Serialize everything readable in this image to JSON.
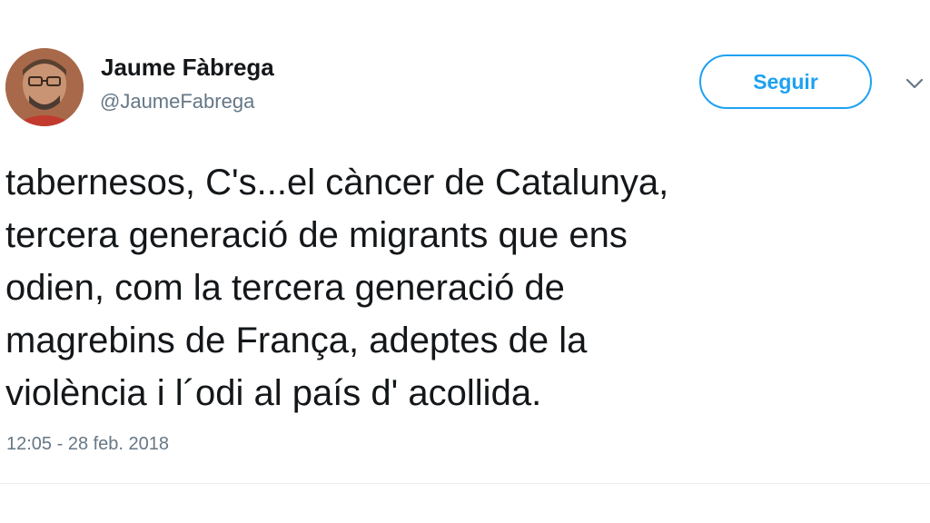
{
  "author": {
    "display_name": "Jaume Fàbrega",
    "handle": "@JaumeFabrega",
    "avatar_icon": "profile-photo"
  },
  "actions": {
    "follow_label": "Seguir",
    "menu_icon": "chevron-down-icon"
  },
  "tweet": {
    "text": "tabernesos,   C's...el càncer de Catalunya,\ntercera generació de migrants que  ens\nodien, com la tercera generació de\nmagrebins de França, adeptes de  la\nviolència i l´odi al país d' acollida.",
    "timestamp": "12:05 - 28 feb. 2018"
  },
  "colors": {
    "accent": "#1da1f2",
    "text_primary": "#14171a",
    "text_secondary": "#657786",
    "divider": "#e6ecf0"
  }
}
